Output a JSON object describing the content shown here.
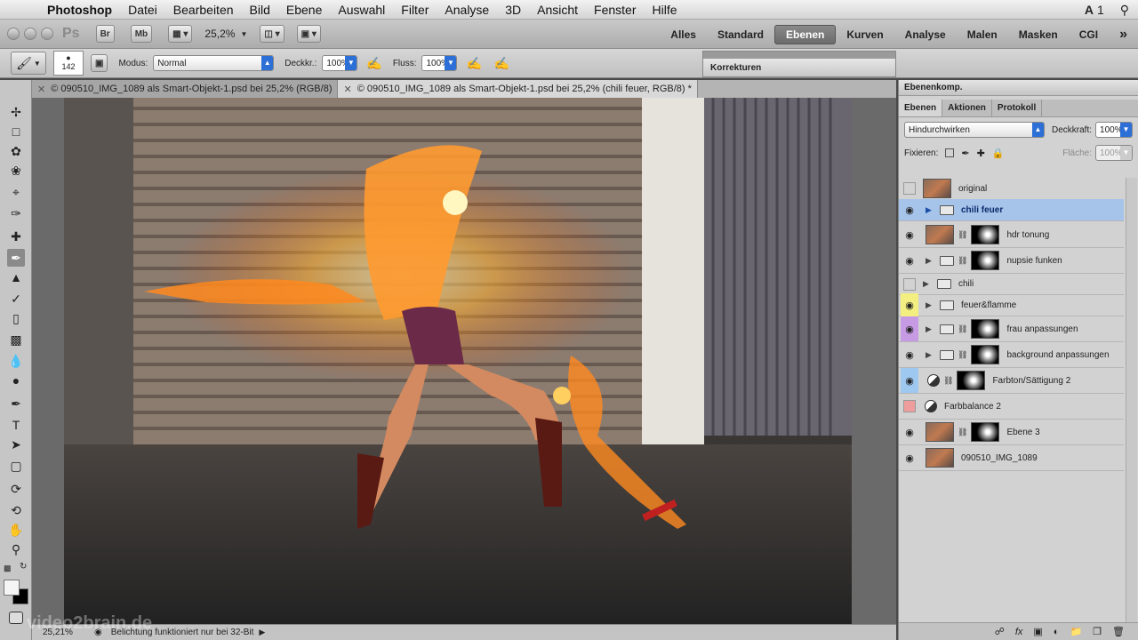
{
  "menubar": {
    "app": "Photoshop",
    "items": [
      "Datei",
      "Bearbeiten",
      "Bild",
      "Ebene",
      "Auswahl",
      "Filter",
      "Analyse",
      "3D",
      "Ansicht",
      "Fenster",
      "Hilfe"
    ],
    "right_badge": "1"
  },
  "appbar": {
    "logo": "Ps",
    "br": "Br",
    "mb": "Mb",
    "zoom": "25,2%",
    "workspaces": [
      "Alles",
      "Standard",
      "Ebenen",
      "Kurven",
      "Analyse",
      "Malen",
      "Masken",
      "CGI"
    ],
    "active_workspace": "Ebenen",
    "more": "»"
  },
  "options": {
    "brush_size": "142",
    "modus_label": "Modus:",
    "modus_value": "Normal",
    "deckkr_label": "Deckkr.:",
    "deckkr_value": "100%",
    "fluss_label": "Fluss:",
    "fluss_value": "100%"
  },
  "korrekturen": {
    "title": "Korrekturen"
  },
  "tabs": [
    {
      "label": "© 090510_IMG_1089 als Smart-Objekt-1.psd bei 25,2% (RGB/8)",
      "active": false
    },
    {
      "label": "© 090510_IMG_1089 als Smart-Objekt-1.psd bei 25,2% (chili feuer, RGB/8) *",
      "active": true
    }
  ],
  "status": {
    "zoom": "25,21%",
    "message": "Belichtung funktioniert nur bei 32-Bit"
  },
  "watermark": "video2brain.de",
  "panel": {
    "comp_title": "Ebenenkomp.",
    "tabs": [
      "Ebenen",
      "Aktionen",
      "Protokoll"
    ],
    "blend_mode": "Hindurchwirken",
    "opacity_label": "Deckkraft:",
    "opacity_value": "100%",
    "lock_label": "Fixieren:",
    "fill_label": "Fläche:",
    "fill_value": "100%",
    "layers": [
      {
        "name": "original",
        "kind": "image",
        "eye": false,
        "color": ""
      },
      {
        "name": "chili feuer",
        "kind": "group",
        "eye": true,
        "color": "",
        "selected": true
      },
      {
        "name": "hdr tonung",
        "kind": "image-mask",
        "eye": true,
        "color": ""
      },
      {
        "name": "nupsie funken",
        "kind": "group-mask",
        "eye": true,
        "color": ""
      },
      {
        "name": "chili",
        "kind": "group",
        "eye": false,
        "color": ""
      },
      {
        "name": "feuer&flamme",
        "kind": "group",
        "eye": true,
        "color": "#f2ee80"
      },
      {
        "name": "frau anpassungen",
        "kind": "group-mask",
        "eye": true,
        "color": "#c79be3"
      },
      {
        "name": "background anpassungen",
        "kind": "group-mask",
        "eye": true,
        "color": ""
      },
      {
        "name": "Farbton/Sättigung 2",
        "kind": "adj-mask",
        "eye": true,
        "color": "#9ec8ef"
      },
      {
        "name": "Farbbalance 2",
        "kind": "adj",
        "eye": false,
        "color": "#ef9c9c"
      },
      {
        "name": "Ebene 3",
        "kind": "image-mask",
        "eye": true,
        "color": ""
      },
      {
        "name": "090510_IMG_1089",
        "kind": "smart",
        "eye": true,
        "color": ""
      }
    ]
  }
}
